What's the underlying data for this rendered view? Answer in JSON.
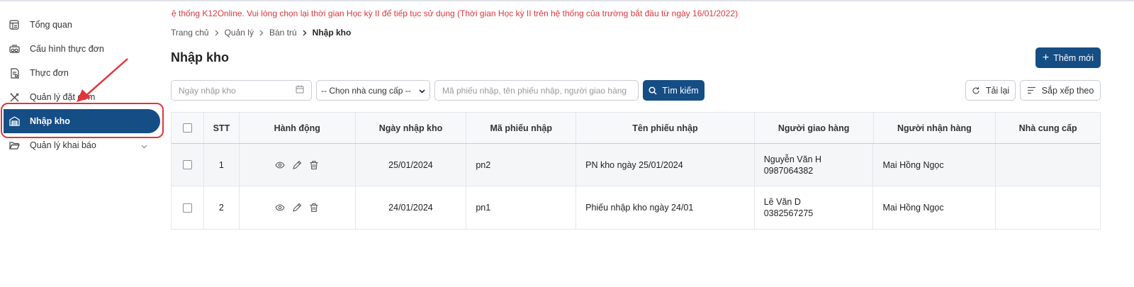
{
  "notice": "ệ thống K12Online. Vui lòng chọn lại thời gian Học kỳ II để tiếp tục sử dụng (Thời gian Học kỳ II trên hệ thống của trường bắt đầu từ ngày 16/01/2022)",
  "sidebar": {
    "items": [
      {
        "label": "Tổng quan",
        "icon": "dashboard-icon"
      },
      {
        "label": "Cấu hình thực đơn",
        "icon": "menu-config-icon"
      },
      {
        "label": "Thực đơn",
        "icon": "menu-document-icon"
      },
      {
        "label": "Quản lý đặt cơm",
        "icon": "utensils-icon"
      },
      {
        "label": "Nhập kho",
        "icon": "warehouse-icon"
      },
      {
        "label": "Quản lý khai báo",
        "icon": "folder-icon"
      }
    ],
    "active": "Nhập kho"
  },
  "breadcrumb": [
    "Trang chủ",
    "Quản lý",
    "Bán trú",
    "Nhập kho"
  ],
  "page_title": "Nhập kho",
  "toolbar": {
    "add_label": "Thêm mới",
    "date_placeholder": "Ngày nhập kho",
    "supplier_selected": "-- Chọn nhà cung cấp --",
    "search_placeholder": "Mã phiếu nhập, tên phiếu nhập, người giao hàng",
    "search_label": "Tìm kiếm",
    "reload_label": "Tải lại",
    "sort_label": "Sắp xếp theo"
  },
  "table": {
    "headers": [
      "STT",
      "Hành động",
      "Ngày nhập kho",
      "Mã phiếu nhập",
      "Tên phiếu nhập",
      "Người giao hàng",
      "Người nhận hàng",
      "Nhà cung cấp"
    ],
    "rows": [
      {
        "stt": "1",
        "date": "25/01/2024",
        "code": "pn2",
        "name": "PN kho ngày 25/01/2024",
        "deliverer_name": "Nguyễn Văn H",
        "deliverer_phone": "0987064382",
        "receiver": "Mai Hồng Ngọc",
        "supplier": ""
      },
      {
        "stt": "2",
        "date": "24/01/2024",
        "code": "pn1",
        "name": "Phiếu nhập kho ngày 24/01",
        "deliverer_name": "Lê Văn D",
        "deliverer_phone": "0382567275",
        "receiver": "Mai Hồng Ngọc",
        "supplier": ""
      }
    ]
  },
  "colors": {
    "primary": "#154d85",
    "notice": "#e0353b",
    "highlight": "#e0353b"
  }
}
